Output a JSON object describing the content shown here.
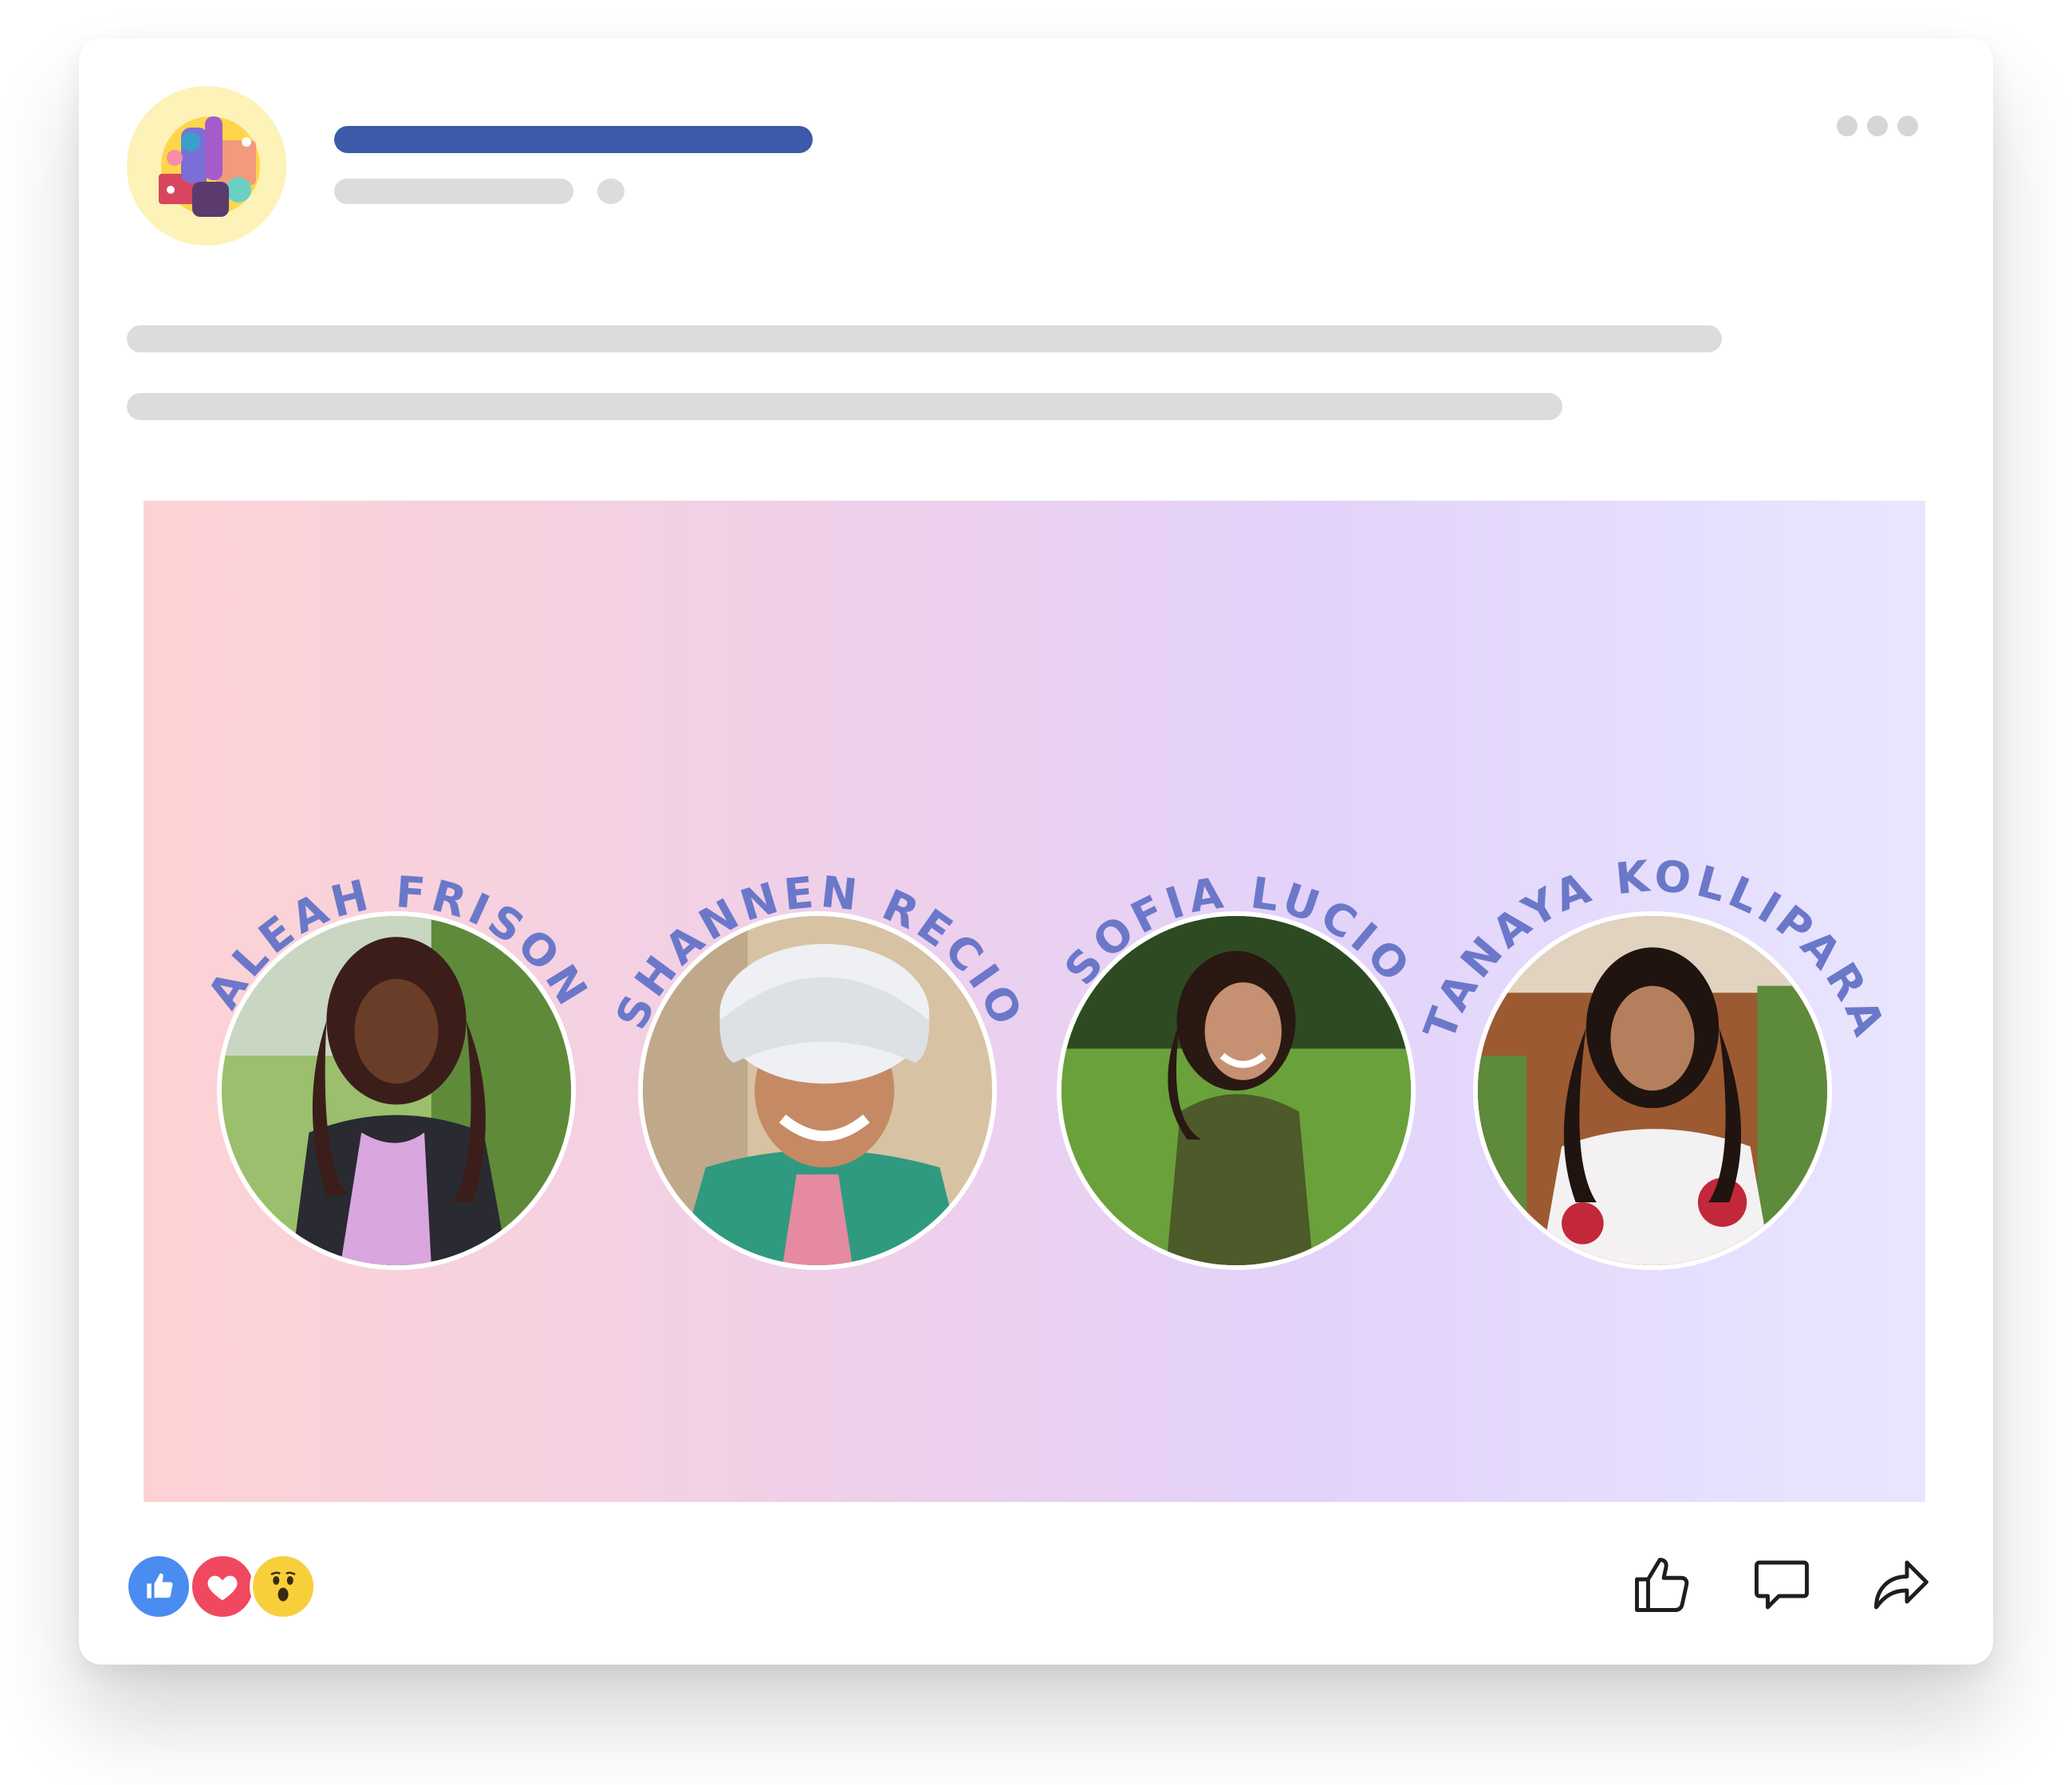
{
  "post": {
    "colors": {
      "header_name_bar": "#3c5aa8",
      "placeholder_bar": "#dcdcdc",
      "name_text": "#6b78c9",
      "banner_gradient": [
        "#fdd2d4",
        "#efd0ea",
        "#e3d2fa",
        "#e8e6ff"
      ]
    },
    "author_avatar_icon": "illustrated-community-icon",
    "more_menu_icon": "ellipsis-icon"
  },
  "banner": {
    "people": [
      {
        "name": "ALEAH FRISON"
      },
      {
        "name": "SHANNEN RECIO"
      },
      {
        "name": "SOFIA LUCIO"
      },
      {
        "name": "TANAYA KOLLIPARA"
      }
    ]
  },
  "footer": {
    "reactions": [
      "like-reaction-icon",
      "love-reaction-icon",
      "wow-reaction-icon"
    ],
    "actions": [
      "like-icon",
      "comment-icon",
      "share-icon"
    ]
  }
}
